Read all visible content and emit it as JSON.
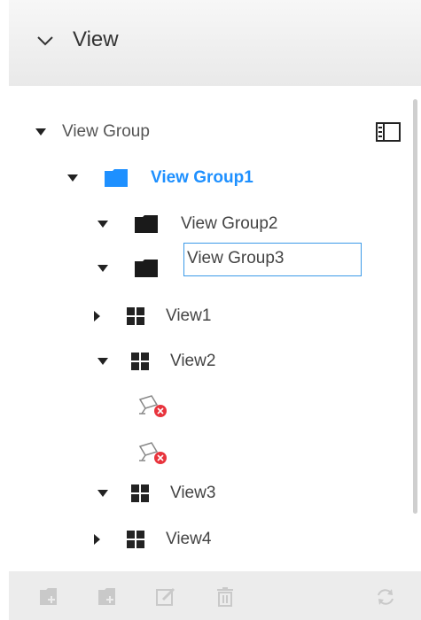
{
  "header": {
    "title": "View"
  },
  "tree": {
    "root_label": "View Group",
    "group1_label": "View Group1",
    "group2_label": "View Group2",
    "group3_edit_value": "View Group3",
    "views": {
      "view1": "View1",
      "view2": "View2",
      "view3": "View3",
      "view4": "View4"
    }
  },
  "icons": {
    "collapse": "chevron-down-icon",
    "panel": "panel-toggle-icon",
    "folder": "folder-icon",
    "view": "grid-icon",
    "camera_offline": "camera-offline-icon"
  },
  "toolbar": {
    "buttons": [
      "add-group-icon",
      "add-view-icon",
      "edit-icon",
      "delete-icon",
      "refresh-icon"
    ]
  },
  "colors": {
    "accent": "#1e90ff",
    "error": "#e8343d",
    "toolbar_bg": "#ececec",
    "header_bg": "#eeeeee"
  }
}
